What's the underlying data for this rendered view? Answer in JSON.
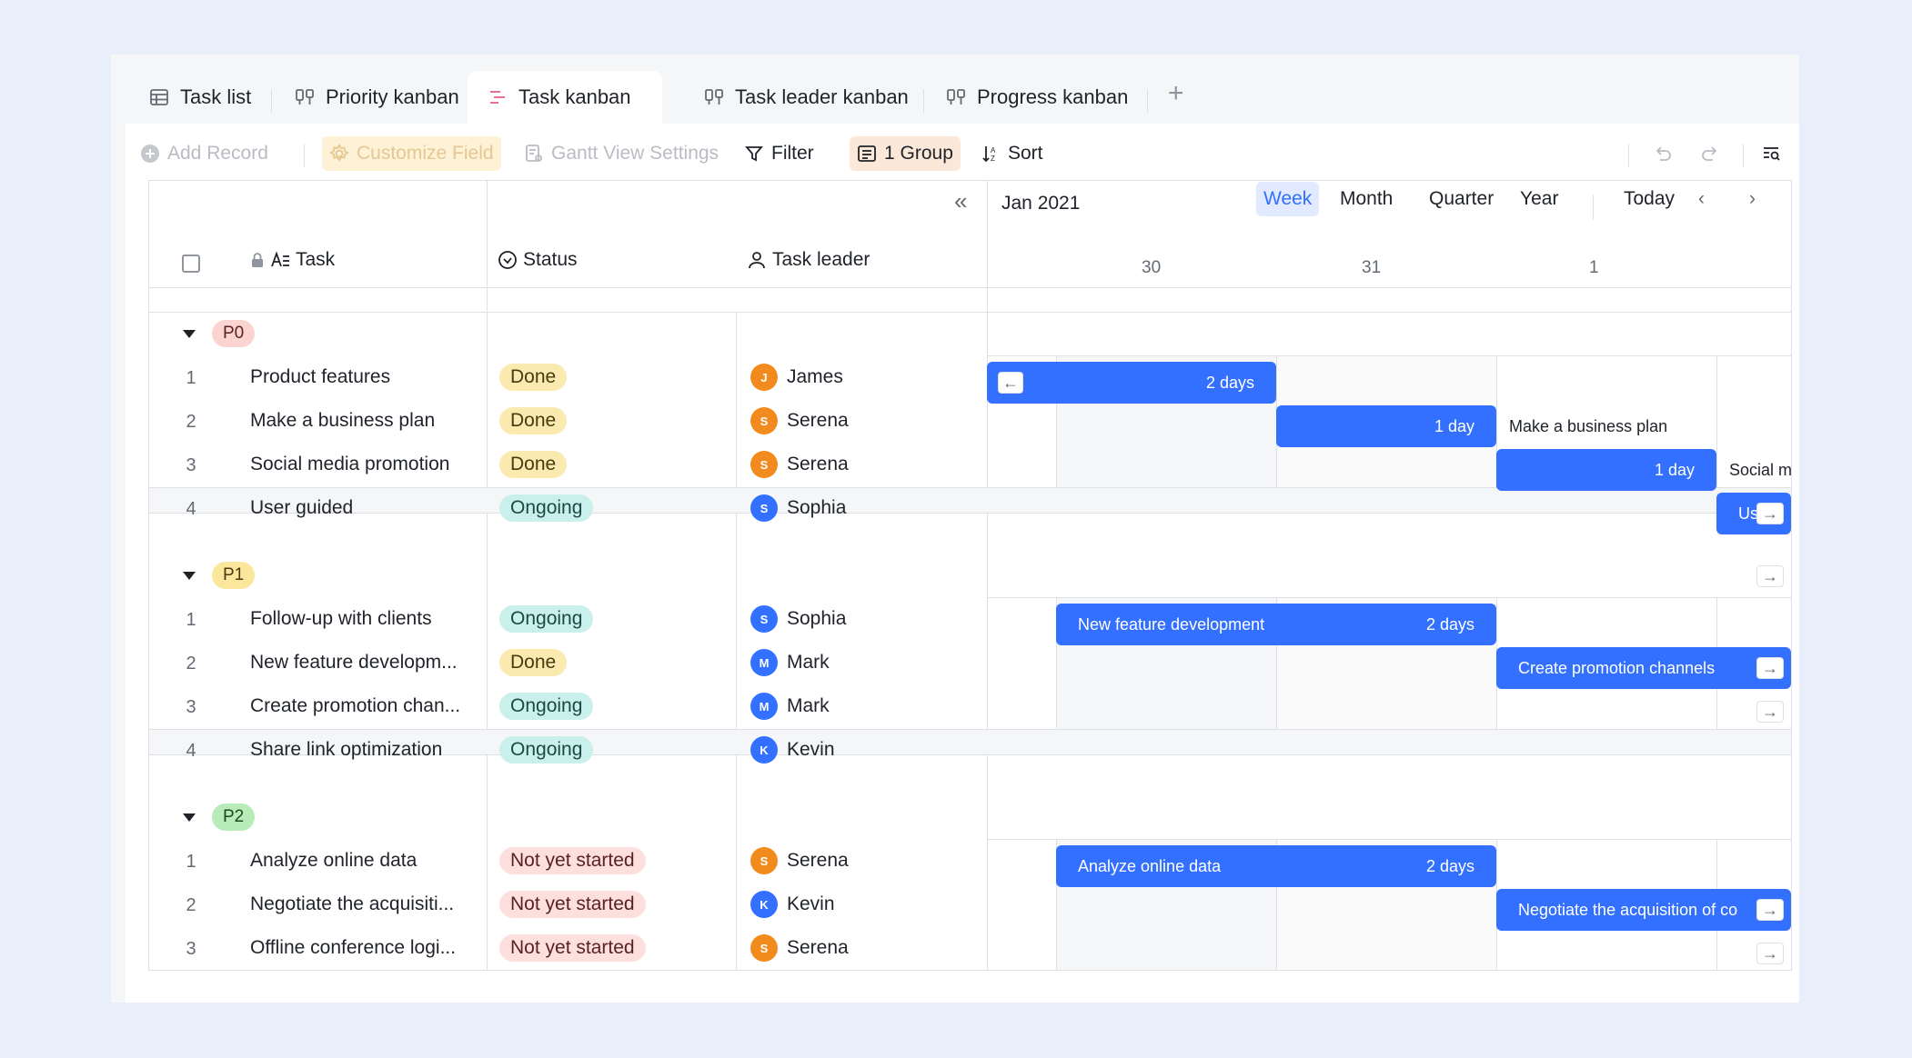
{
  "tabs": [
    {
      "label": "Task list",
      "icon": "table-icon"
    },
    {
      "label": "Priority kanban",
      "icon": "kanban-icon"
    },
    {
      "label": "Task kanban",
      "icon": "gantt-icon",
      "active": true
    },
    {
      "label": "Task leader kanban",
      "icon": "kanban-icon"
    },
    {
      "label": "Progress kanban",
      "icon": "kanban-icon"
    }
  ],
  "tab_add": "+",
  "toolbar": {
    "add_record": "Add Record",
    "customize_field": "Customize Field",
    "gantt_settings": "Gantt View Settings",
    "filter": "Filter",
    "group": "1 Group",
    "sort": "Sort"
  },
  "columns": {
    "task": "Task",
    "status": "Status",
    "leader": "Task leader"
  },
  "gantt": {
    "month": "Jan 2021",
    "views": [
      "Week",
      "Month",
      "Quarter",
      "Year"
    ],
    "active_view": "Week",
    "today": "Today",
    "dates": [
      "30",
      "31",
      "1"
    ]
  },
  "groups": [
    {
      "name": "P0",
      "color": "#fbd3d0",
      "text": "#5b2120",
      "rows": [
        {
          "num": "1",
          "task": "Product features",
          "status": "Done",
          "status_class": "st-done",
          "leader": "James",
          "initial": "J",
          "avatar": "#f28b1e"
        },
        {
          "num": "2",
          "task": "Make a business plan",
          "status": "Done",
          "status_class": "st-done",
          "leader": "Serena",
          "initial": "S",
          "avatar": "#f28b1e"
        },
        {
          "num": "3",
          "task": "Social media promotion",
          "status": "Done",
          "status_class": "st-done",
          "leader": "Serena",
          "initial": "S",
          "avatar": "#f28b1e"
        },
        {
          "num": "4",
          "task": "User guided",
          "status": "Ongoing",
          "status_class": "st-ongoing",
          "leader": "Sophia",
          "initial": "S",
          "avatar": "#3370ff"
        }
      ]
    },
    {
      "name": "P1",
      "color": "#fbe79c",
      "text": "#4a3810",
      "rows": [
        {
          "num": "1",
          "task": "Follow-up with clients",
          "status": "Ongoing",
          "status_class": "st-ongoing",
          "leader": "Sophia",
          "initial": "S",
          "avatar": "#3370ff"
        },
        {
          "num": "2",
          "task": "New feature developm...",
          "status": "Done",
          "status_class": "st-done",
          "leader": "Mark",
          "initial": "M",
          "avatar": "#3370ff"
        },
        {
          "num": "3",
          "task": "Create promotion chan...",
          "status": "Ongoing",
          "status_class": "st-ongoing",
          "leader": "Mark",
          "initial": "M",
          "avatar": "#3370ff"
        },
        {
          "num": "4",
          "task": "Share link optimization",
          "status": "Ongoing",
          "status_class": "st-ongoing",
          "leader": "Kevin",
          "initial": "K",
          "avatar": "#3370ff"
        }
      ]
    },
    {
      "name": "P2",
      "color": "#b7ecb8",
      "text": "#1c4a1e",
      "rows": [
        {
          "num": "1",
          "task": "Analyze online data",
          "status": "Not yet started",
          "status_class": "st-not",
          "leader": "Serena",
          "initial": "S",
          "avatar": "#f28b1e"
        },
        {
          "num": "2",
          "task": "Negotiate the acquisiti...",
          "status": "Not yet started",
          "status_class": "st-not",
          "leader": "Kevin",
          "initial": "K",
          "avatar": "#3370ff"
        },
        {
          "num": "3",
          "task": "Offline conference logi...",
          "status": "Not yet started",
          "status_class": "st-not",
          "leader": "Serena",
          "initial": "S",
          "avatar": "#f28b1e"
        }
      ]
    }
  ],
  "bars": {
    "b1_dur": "2 days",
    "b2_dur": "1 day",
    "b2_label": "Make a business plan",
    "b3_dur": "1 day",
    "b3_label": "Social m",
    "b4_label": "Us",
    "b5_label": "New feature development",
    "b5_dur": "2 days",
    "b6_label": "Create promotion channels",
    "b7_label": "Analyze online data",
    "b7_dur": "2 days",
    "b8_label": "Negotiate the acquisition of co"
  },
  "colors": {
    "accent": "#3370ff",
    "tab_active_icon": "#e8618c"
  }
}
